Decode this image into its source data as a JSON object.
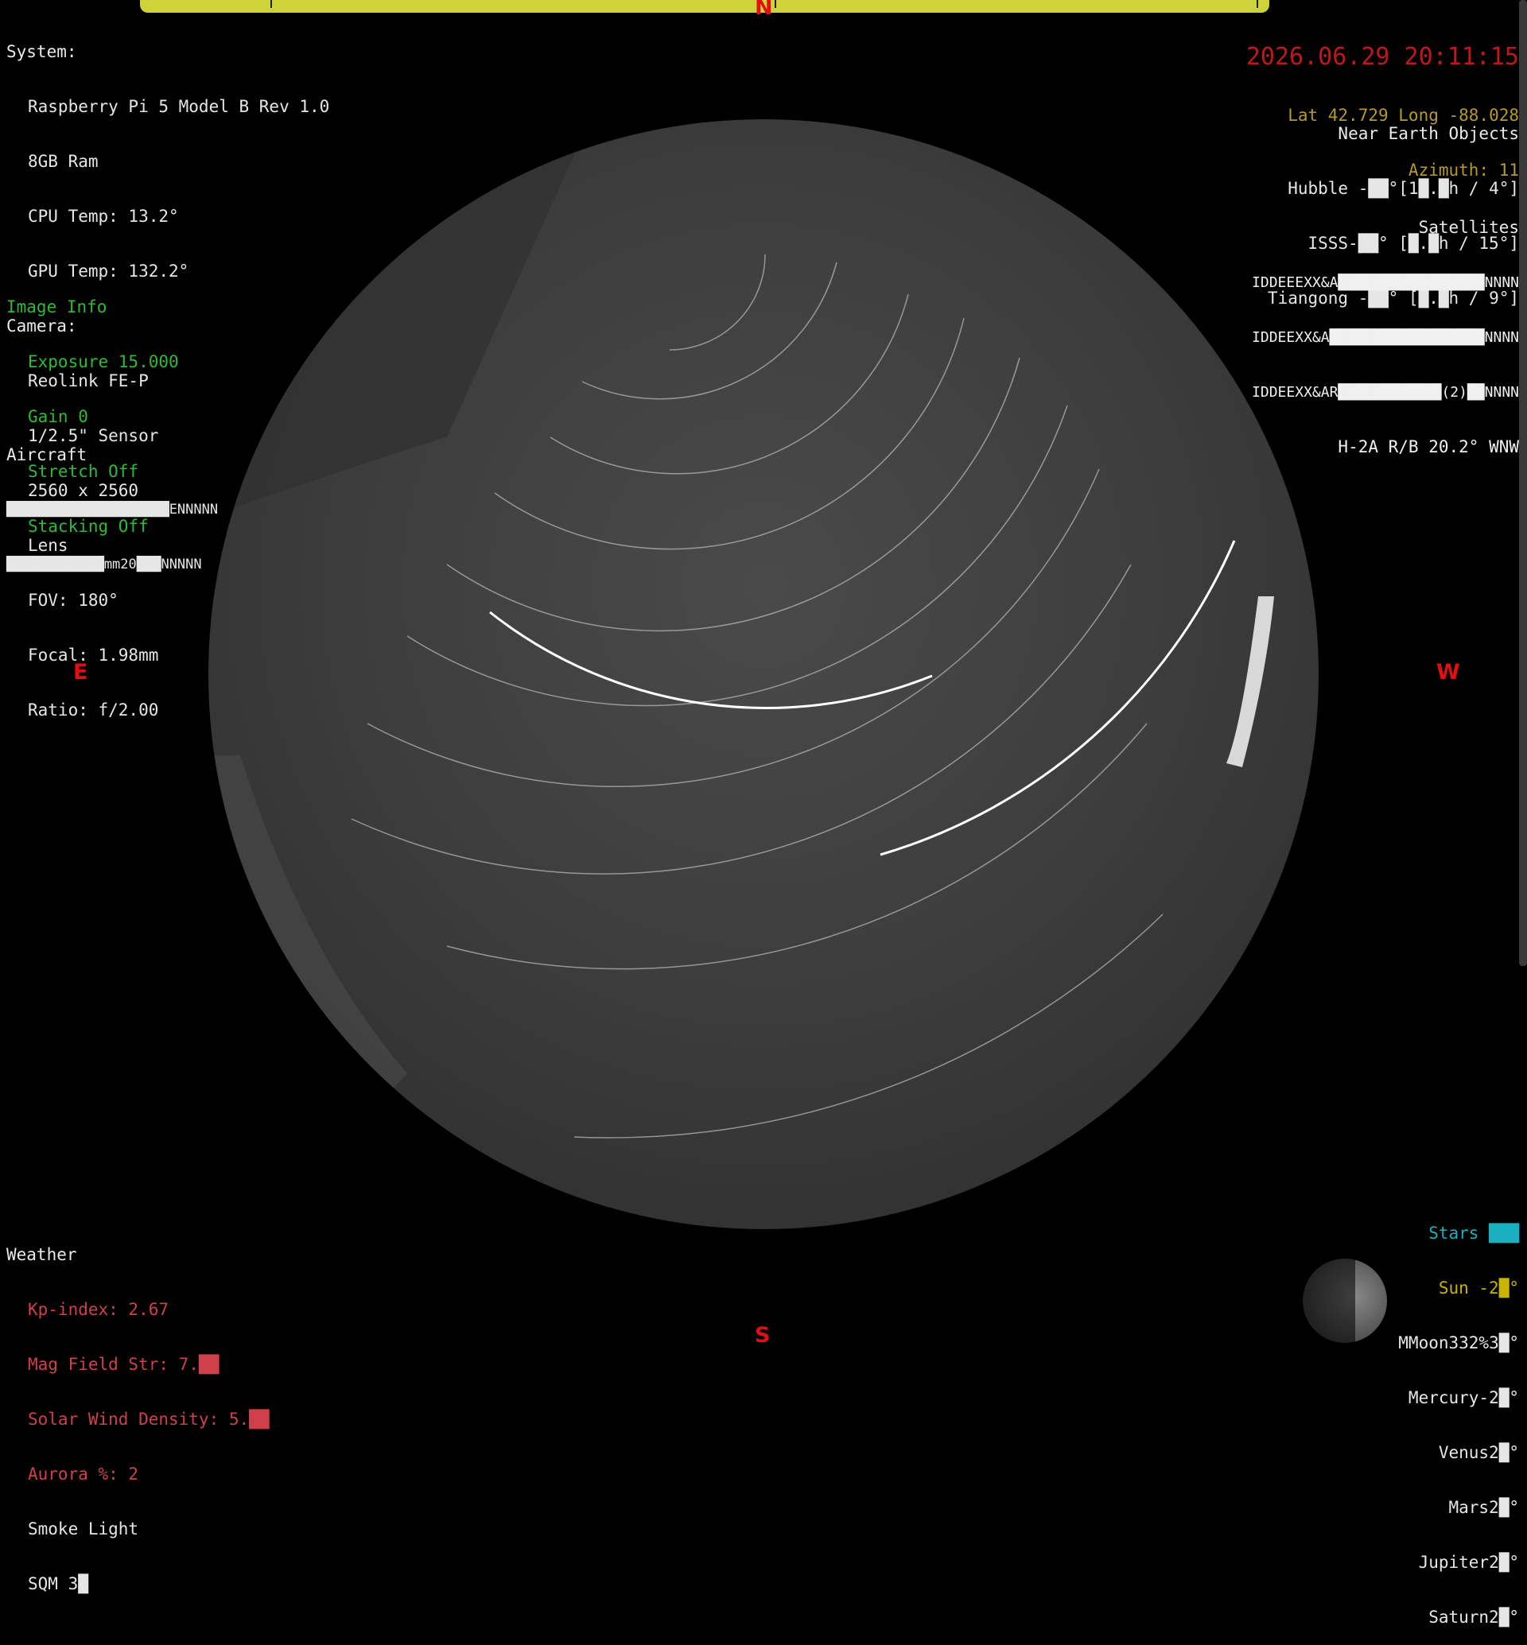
{
  "system": {
    "heading": "System:",
    "lines": [
      "Raspberry Pi 5 Model B Rev 1.0",
      "8GB Ram",
      "CPU Temp: 13.2°",
      "GPU Temp: 132.2°"
    ]
  },
  "camera": {
    "heading": "Camera:",
    "lines": [
      "Reolink FE-P",
      "1/2.5\" Sensor",
      "2560 x 2560",
      "Lens",
      "FOV: 180°",
      "Focal: 1.98mm",
      "Ratio: f/2.00"
    ]
  },
  "image_info": {
    "heading": "Image Info",
    "lines": [
      "Exposure 15.000",
      "Gain 0",
      "Stretch Off",
      "Stacking Off"
    ]
  },
  "aircraft": {
    "heading": "Aircraft",
    "lines": [
      "████████████████████ENNNNN",
      "████████████mm20███NNNNN"
    ]
  },
  "weather": {
    "heading": "Weather",
    "lines": [
      "Kp-index: 2.67",
      "Mag Field Str: 7.██",
      "Solar Wind Density: 5.██",
      "Aurora %: 2"
    ],
    "plain": [
      "Smoke Light",
      "SQM 3█"
    ]
  },
  "top_right": {
    "datetime": "2026.06.29 20:11:15",
    "latlong": "Lat 42.729 Long -88.028",
    "azimuth": "Azimuth: 11"
  },
  "near_earth": {
    "heading": "Near Earth Objects",
    "lines": [
      "Hubble -██°[1█.█h / 4°]",
      "ISSS-██° [█.█h / 15°]",
      "Tiangong -██° [█.█h / 9°]"
    ]
  },
  "satellites": {
    "heading": "Satellites",
    "lines": [
      "IDDEEEXX&A█████████████████NNNN",
      "IDDEEXX&A██████████████████NNNN",
      "IDDEEXX&AR████████████(2)██NNNN",
      "H-2A R/B 20.2° WNW"
    ]
  },
  "bodies": {
    "stars": "Stars ███",
    "sun": "Sun -2█°",
    "lines": [
      "MMoon332%3█°",
      "Mercury-2█°",
      "Venus2█°",
      "Mars2█°",
      "Jupiter2█°",
      "Saturn2█°"
    ]
  },
  "compass": {
    "n": "N",
    "s": "S",
    "e": "E",
    "w": "W"
  },
  "colors": {
    "topbar": "#cfd33a",
    "compass": "#e01010",
    "image_info": "#2dbb35",
    "weather": "#d0404a"
  }
}
